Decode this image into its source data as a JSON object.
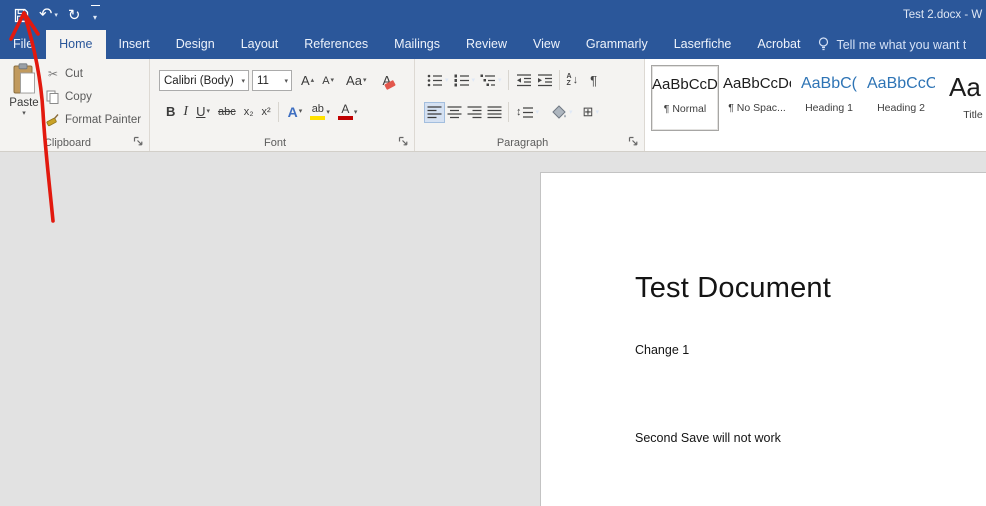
{
  "titlebar": {
    "document_title": "Test 2.docx - W"
  },
  "icons": {
    "undo": "↶",
    "redo": "↻",
    "caret": "▾",
    "caret_up": "▴",
    "scissors": "✂",
    "pilcrow": "¶",
    "borders": "⊞",
    "sort_a": "A",
    "sort_z": "Z",
    "sort_arrow": "↓",
    "spacing": "↕"
  },
  "tabs": [
    "File",
    "Home",
    "Insert",
    "Design",
    "Layout",
    "References",
    "Mailings",
    "Review",
    "View",
    "Grammarly",
    "Laserfiche",
    "Acrobat"
  ],
  "tellme": {
    "label": "Tell me what you want t"
  },
  "clipboard": {
    "label": "Clipboard",
    "paste": "Paste",
    "cut": "Cut",
    "copy": "Copy",
    "format_painter": "Format Painter"
  },
  "font": {
    "label": "Font",
    "family": "Calibri (Body)",
    "size": "11",
    "bold": "B",
    "italic": "I",
    "underline": "U",
    "strikethrough": "abc",
    "subscript": "x₂",
    "superscript": "x²",
    "change_case": "Aa",
    "grow": "A",
    "shrink": "A",
    "clear_formatting": "A",
    "text_effects": "A",
    "highlight": "ab",
    "font_color": "A"
  },
  "paragraph": {
    "label": "Paragraph"
  },
  "styles": {
    "items": [
      {
        "preview": "AaBbCcDc",
        "name": "¶ Normal"
      },
      {
        "preview": "AaBbCcDc",
        "name": "¶ No Spac..."
      },
      {
        "preview": "AaBbC(",
        "name": "Heading 1"
      },
      {
        "preview": "AaBbCcC",
        "name": "Heading 2"
      },
      {
        "preview": "Aa",
        "name": "Title"
      }
    ]
  },
  "document": {
    "title": "Test Document",
    "paragraph1": "Change 1",
    "paragraph2": "Second Save will not work"
  },
  "colors": {
    "accent": "#2b579a",
    "annotation_red": "#e2190e",
    "heading_blue": "#2e74b5",
    "highlight_yellow": "#ffe100",
    "font_color_red": "#c00000"
  }
}
